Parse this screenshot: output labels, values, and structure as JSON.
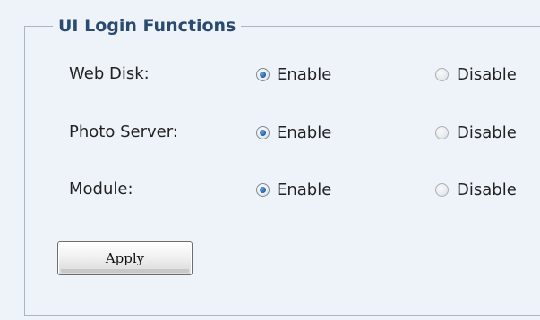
{
  "group": {
    "title": "UI Login Functions"
  },
  "rows": [
    {
      "label": "Web Disk:",
      "selected": "Enable",
      "options": [
        "Enable",
        "Disable"
      ]
    },
    {
      "label": "Photo Server:",
      "selected": "Enable",
      "options": [
        "Enable",
        "Disable"
      ]
    },
    {
      "label": "Module:",
      "selected": "Enable",
      "options": [
        "Enable",
        "Disable"
      ]
    }
  ],
  "actions": {
    "apply_label": "Apply"
  }
}
